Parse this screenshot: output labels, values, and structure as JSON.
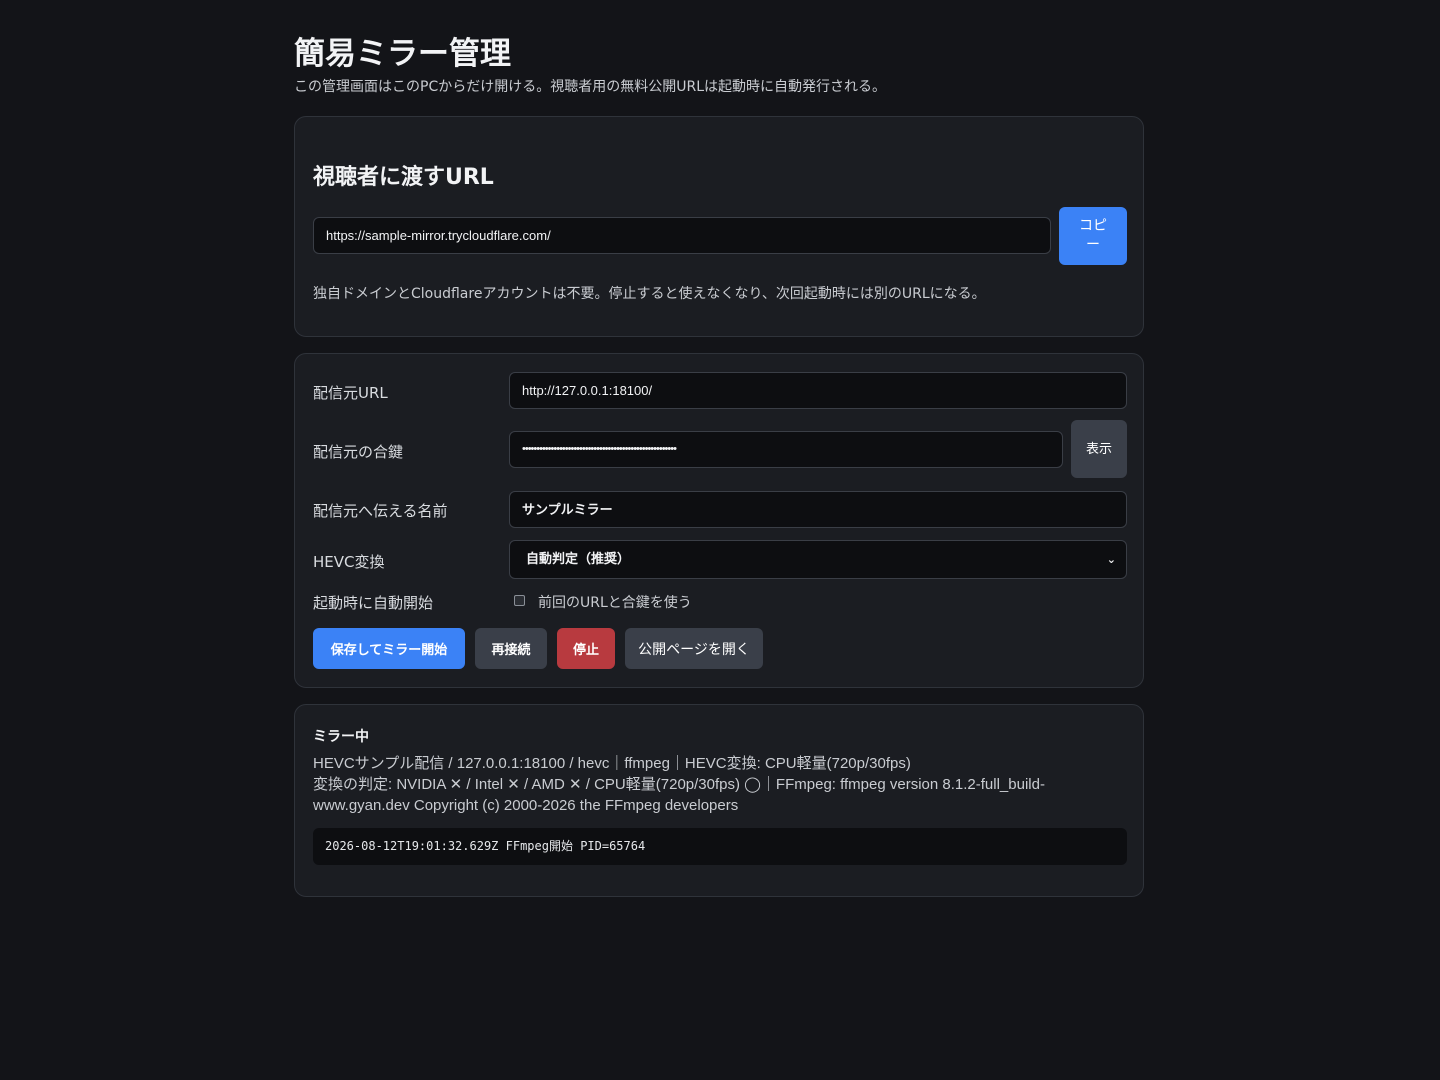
{
  "page": {
    "title": "簡易ミラー管理",
    "subtitle": "この管理画面はこのPCからだけ開ける。視聴者用の無料公開URLは起動時に自動発行される。"
  },
  "viewer_url_card": {
    "title": "視聴者に渡すURL",
    "url_value": "https://sample-mirror.trycloudflare.com/",
    "copy_label": "コピー",
    "note": "独自ドメインとCloudflareアカウントは不要。停止すると使えなくなり、次回起動時には別のURLになる。"
  },
  "settings": {
    "source_url_label": "配信元URL",
    "source_url_value": "http://127.0.0.1:18100/",
    "key_label": "配信元の合鍵",
    "key_value": "••••••••••••••••••••••••••••••••••••••••••••••••••••••",
    "show_label": "表示",
    "name_label": "配信元へ伝える名前",
    "name_value": "サンプルミラー",
    "hevc_label": "HEVC変換",
    "hevc_selected": "自動判定（推奨）",
    "autostart_label": "起動時に自動開始",
    "autostart_checked": false,
    "autostart_checkbox_label": "前回のURLと合鍵を使う",
    "buttons": {
      "save_start": "保存してミラー開始",
      "reconnect": "再接続",
      "stop": "停止",
      "open_public": "公開ページを開く"
    }
  },
  "status": {
    "title": "ミラー中",
    "line1": "HEVCサンプル配信 / 127.0.0.1:18100 / hevc｜ffmpeg｜HEVC変換: CPU軽量(720p/30fps)",
    "line2": "変換の判定: NVIDIA ✕ / Intel ✕ / AMD ✕ / CPU軽量(720p/30fps) ◯｜FFmpeg: ffmpeg version 8.1.2-full_build-www.gyan.dev Copyright (c) 2000-2026 the FFmpeg developers",
    "log": "2026-08-12T19:01:32.629Z FFmpeg開始 PID=65764"
  },
  "colors": {
    "background": "#131418",
    "card": "#1b1d22",
    "primary": "#3b82f6",
    "danger": "#b83a3f",
    "secondary": "#3a3f49"
  }
}
